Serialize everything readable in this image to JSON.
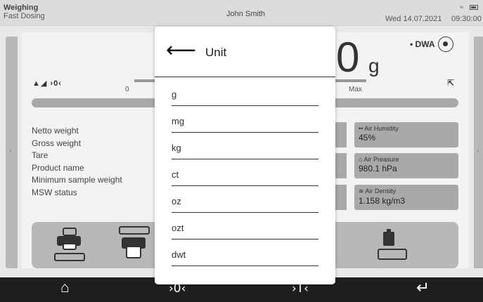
{
  "topbar": {
    "mode_line1": "Weighing",
    "mode_line2": "Fast Dosing",
    "user": "John Smith",
    "date": "Wed 14.07.2021",
    "time": "09:30:00",
    "wifi_icon": "wifi-icon",
    "battery_icon": "battery-icon"
  },
  "sidetabs": {
    "left_arrow": "›",
    "right_arrow": "‹"
  },
  "weighing": {
    "value": "0",
    "unit": "g",
    "dwa_label": "• DWA",
    "stable_indicator": "▲◢ ›0‹",
    "tilt_symbol": "⇱",
    "bar_min": "0",
    "bar_max": "Max",
    "progress": 0,
    "info_lines": [
      "Netto weight",
      "Gross weight",
      "Tare",
      "Product name",
      "Minimum sample weight",
      "MSW status"
    ]
  },
  "sensors": [
    {
      "label": "•• Air Humidity",
      "value": "45%"
    },
    {
      "label": "⌂ Air Preasure",
      "value": "980.1 hPa"
    },
    {
      "label": "≋ Air Density",
      "value": "1.158 kg/m3"
    }
  ],
  "bottombar": {
    "home": "⌂",
    "zero": "›0‹",
    "tare": "›T‹",
    "enter": "↵"
  },
  "modal": {
    "back": "⟵",
    "title": "Unit",
    "units": [
      "g",
      "mg",
      "kg",
      "ct",
      "oz",
      "ozt",
      "dwt"
    ]
  },
  "colors": {
    "bottom_bar": "#1e1e1e",
    "panel": "#f3f3f3",
    "accent_gray": "#a9a9a9"
  }
}
